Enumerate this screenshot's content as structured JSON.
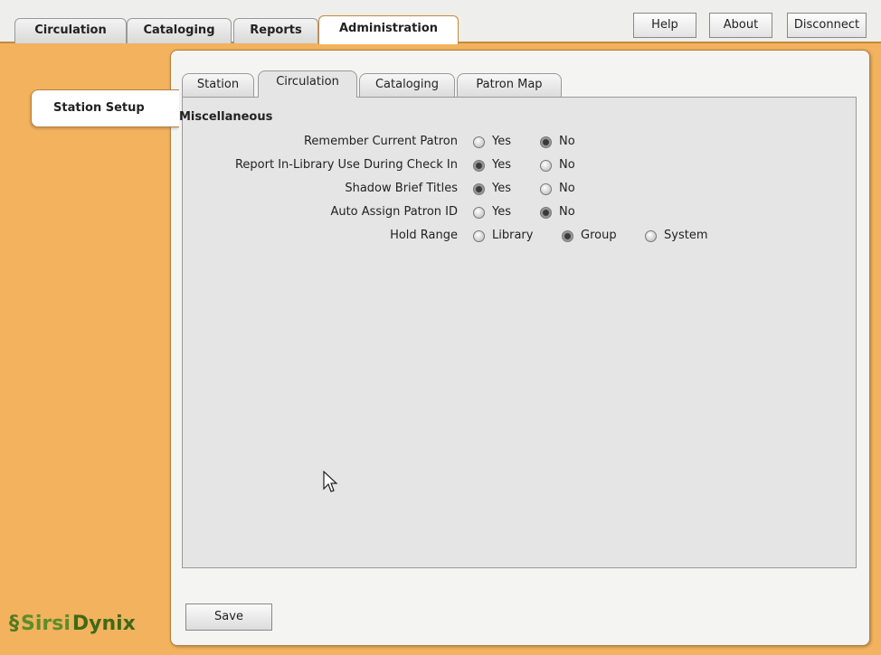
{
  "main_tabs": [
    {
      "label": "Circulation"
    },
    {
      "label": "Cataloging"
    },
    {
      "label": "Reports"
    },
    {
      "label": "Administration",
      "active": true
    }
  ],
  "top_buttons": [
    {
      "label": "Help"
    },
    {
      "label": "About"
    },
    {
      "label": "Disconnect"
    }
  ],
  "sidebar": {
    "items": [
      {
        "label": "Station Setup",
        "active": true
      }
    ]
  },
  "sub_tabs": [
    {
      "label": "Station"
    },
    {
      "label": "Circulation",
      "active": true
    },
    {
      "label": "Cataloging"
    },
    {
      "label": "Patron Map"
    }
  ],
  "section": {
    "title": "Miscellaneous"
  },
  "settings": [
    {
      "label": "Remember Current Patron",
      "options": [
        "Yes",
        "No"
      ],
      "selected": "No"
    },
    {
      "label": "Report In-Library Use During Check In",
      "options": [
        "Yes",
        "No"
      ],
      "selected": "Yes"
    },
    {
      "label": "Shadow Brief Titles",
      "options": [
        "Yes",
        "No"
      ],
      "selected": "Yes"
    },
    {
      "label": "Auto Assign Patron ID",
      "options": [
        "Yes",
        "No"
      ],
      "selected": "No"
    },
    {
      "label": "Hold Range",
      "options": [
        "Library",
        "Group",
        "System"
      ],
      "selected": "Group"
    }
  ],
  "save_label": "Save",
  "logo": {
    "part1": "Sirsi",
    "part2": "Dynix"
  },
  "colors": {
    "background": "#f2b25e",
    "panel": "#f4f4f2",
    "form": "#e5e5e5",
    "logo_green": "#5c8d2a"
  }
}
